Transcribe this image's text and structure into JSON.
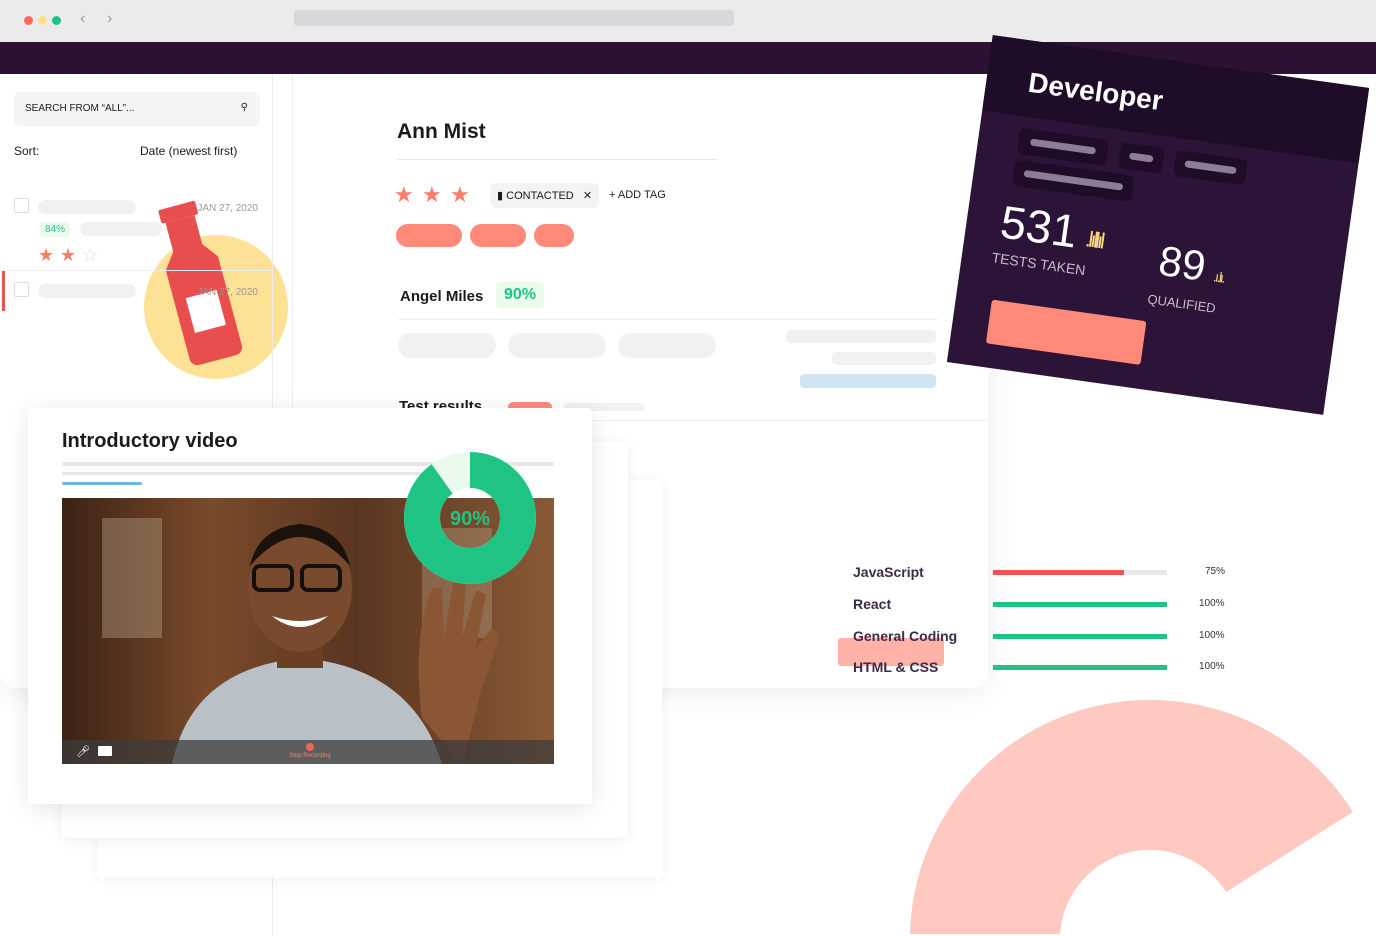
{
  "sidebar": {
    "search_placeholder": "SEARCH FROM “ALL”...",
    "sort_label": "Sort:",
    "sort_value": "Date (newest first)",
    "items": [
      {
        "date": "JAN 27, 2020",
        "score": "84%",
        "rating": 2
      },
      {
        "date": "JAN 27, 2020"
      }
    ]
  },
  "candidate": {
    "name": "Ann Mist",
    "rating": 3,
    "tag": "CONTACTED",
    "add_tag": "+ ADD TAG",
    "reviewer": "Angel Miles",
    "reviewer_score": "90%"
  },
  "tests": {
    "title": "Test results",
    "overall": "90%",
    "overall_value": 90,
    "skills": [
      {
        "name": "JavaScript",
        "percent": "75%",
        "value": 75,
        "color": "#ea5454"
      },
      {
        "name": "React",
        "percent": "100%",
        "value": 100,
        "color": "#1fc485"
      },
      {
        "name": "General Coding",
        "percent": "100%",
        "value": 100,
        "color": "#1fc485"
      },
      {
        "name": "HTML & CSS",
        "percent": "100%",
        "value": 100,
        "color": "#1fc485"
      }
    ]
  },
  "developer_card": {
    "title": "Developer",
    "tests_taken": "531",
    "tests_taken_label": "TESTS TAKEN",
    "qualified": "89",
    "qualified_label": "QUALIFIED"
  },
  "video": {
    "title": "Introductory video",
    "stop_label": "Stop Recording",
    "icons": [
      "microphone-icon",
      "camera-icon"
    ]
  },
  "colors": {
    "accent": "#ff8a7a",
    "purple": "#2b1233",
    "green": "#1fc485",
    "yellow": "#fcdf8e"
  }
}
